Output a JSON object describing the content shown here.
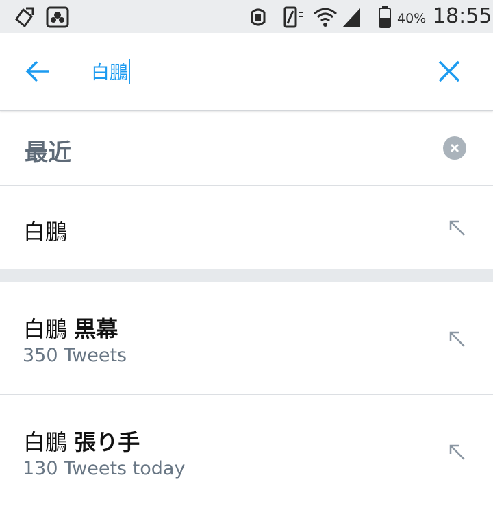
{
  "status_bar": {
    "battery_percent": "40%",
    "time": "18:55",
    "icons": [
      "sync-icon",
      "app-icon",
      "nfc-icon",
      "vibrate-icon",
      "wifi-icon",
      "signal-icon",
      "battery-icon"
    ]
  },
  "search": {
    "query": "白鵬",
    "back_icon": "arrow-left-icon",
    "clear_icon": "close-icon"
  },
  "recent": {
    "title": "最近",
    "clear_icon": "clear-circle-icon",
    "items": [
      {
        "text": "白鵬"
      }
    ]
  },
  "suggestions": [
    {
      "query": "白鵬",
      "bold": "黒幕",
      "count": "350 Tweets"
    },
    {
      "query": "白鵬",
      "bold": "張り手",
      "count": "130 Tweets today"
    }
  ],
  "colors": {
    "accent": "#1d9bf0",
    "muted_text": "#687684",
    "divider": "#dcdfe3"
  }
}
